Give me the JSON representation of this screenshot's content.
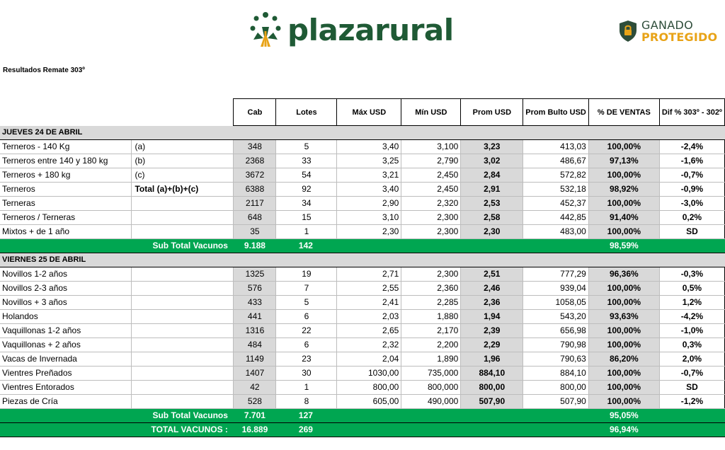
{
  "header": {
    "brand": "plazarural",
    "gp_line1": "GANADO",
    "gp_line2": "PROTEGIDO",
    "subtitle": "Resultados Remate 303º"
  },
  "columns": [
    "Cab",
    "Lotes",
    "Máx USD",
    "Mín USD",
    "Prom USD",
    "Prom Bulto USD",
    "% DE VENTAS",
    "Dif % 303º - 302º"
  ],
  "sections": [
    {
      "title": "JUEVES 24 DE ABRIL",
      "rows": [
        {
          "name": "Terneros - 140 Kg",
          "note": "(a)",
          "cab": "348",
          "lotes": "5",
          "max": "3,40",
          "min": "3,100",
          "prom": "3,23",
          "bulto": "413,03",
          "ventas": "100,00%",
          "dif": "-2,4%"
        },
        {
          "name": "Terneros entre 140 y 180 kg",
          "note": "(b)",
          "cab": "2368",
          "lotes": "33",
          "max": "3,25",
          "min": "2,790",
          "prom": "3,02",
          "bulto": "486,67",
          "ventas": "97,13%",
          "dif": "-1,6%"
        },
        {
          "name": "Terneros + 180 kg",
          "note": "(c)",
          "cab": "3672",
          "lotes": "54",
          "max": "3,21",
          "min": "2,450",
          "prom": "2,84",
          "bulto": "572,82",
          "ventas": "100,00%",
          "dif": "-0,7%"
        },
        {
          "name": "Terneros",
          "note": "Total (a)+(b)+(c)",
          "cab": "6388",
          "lotes": "92",
          "max": "3,40",
          "min": "2,450",
          "prom": "2,91",
          "bulto": "532,18",
          "ventas": "98,92%",
          "dif": "-0,9%"
        },
        {
          "name": "Terneras",
          "note": "",
          "cab": "2117",
          "lotes": "34",
          "max": "2,90",
          "min": "2,320",
          "prom": "2,53",
          "bulto": "452,37",
          "ventas": "100,00%",
          "dif": "-3,0%"
        },
        {
          "name": "Terneros / Terneras",
          "note": "",
          "cab": "648",
          "lotes": "15",
          "max": "3,10",
          "min": "2,300",
          "prom": "2,58",
          "bulto": "442,85",
          "ventas": "91,40%",
          "dif": "0,2%"
        },
        {
          "name": "Mixtos + de 1 año",
          "note": "",
          "cab": "35",
          "lotes": "1",
          "max": "2,30",
          "min": "2,300",
          "prom": "2,30",
          "bulto": "483,00",
          "ventas": "100,00%",
          "dif": "SD"
        }
      ],
      "subtotal": {
        "label": "Sub Total Vacunos",
        "cab": "9.188",
        "lotes": "142",
        "ventas": "98,59%"
      }
    },
    {
      "title": "VIERNES 25 DE ABRIL",
      "rows": [
        {
          "name": "Novillos 1-2 años",
          "note": "",
          "cab": "1325",
          "lotes": "19",
          "max": "2,71",
          "min": "2,300",
          "prom": "2,51",
          "bulto": "777,29",
          "ventas": "96,36%",
          "dif": "-0,3%"
        },
        {
          "name": "Novillos 2-3 años",
          "note": "",
          "cab": "576",
          "lotes": "7",
          "max": "2,55",
          "min": "2,360",
          "prom": "2,46",
          "bulto": "939,04",
          "ventas": "100,00%",
          "dif": "0,5%"
        },
        {
          "name": "Novillos + 3 años",
          "note": "",
          "cab": "433",
          "lotes": "5",
          "max": "2,41",
          "min": "2,285",
          "prom": "2,36",
          "bulto": "1058,05",
          "ventas": "100,00%",
          "dif": "1,2%"
        },
        {
          "name": "Holandos",
          "note": "",
          "cab": "441",
          "lotes": "6",
          "max": "2,03",
          "min": "1,880",
          "prom": "1,94",
          "bulto": "543,20",
          "ventas": "93,63%",
          "dif": "-4,2%"
        },
        {
          "name": "Vaquillonas 1-2 años",
          "note": "",
          "cab": "1316",
          "lotes": "22",
          "max": "2,65",
          "min": "2,170",
          "prom": "2,39",
          "bulto": "656,98",
          "ventas": "100,00%",
          "dif": "-1,0%"
        },
        {
          "name": "Vaquillonas + 2 años",
          "note": "",
          "cab": "484",
          "lotes": "6",
          "max": "2,32",
          "min": "2,200",
          "prom": "2,29",
          "bulto": "790,98",
          "ventas": "100,00%",
          "dif": "0,3%"
        },
        {
          "name": "Vacas de Invernada",
          "note": "",
          "cab": "1149",
          "lotes": "23",
          "max": "2,04",
          "min": "1,890",
          "prom": "1,96",
          "bulto": "790,63",
          "ventas": "86,20%",
          "dif": "2,0%"
        },
        {
          "name": "Vientres Preñados",
          "note": "",
          "cab": "1407",
          "lotes": "30",
          "max": "1030,00",
          "min": "735,000",
          "prom": "884,10",
          "bulto": "884,10",
          "ventas": "100,00%",
          "dif": "-0,7%"
        },
        {
          "name": "Vientres Entorados",
          "note": "",
          "cab": "42",
          "lotes": "1",
          "max": "800,00",
          "min": "800,000",
          "prom": "800,00",
          "bulto": "800,00",
          "ventas": "100,00%",
          "dif": "SD"
        },
        {
          "name": "Piezas de Cría",
          "note": "",
          "cab": "528",
          "lotes": "8",
          "max": "605,00",
          "min": "490,000",
          "prom": "507,90",
          "bulto": "507,90",
          "ventas": "100,00%",
          "dif": "-1,2%"
        }
      ],
      "subtotal": {
        "label": "Sub Total Vacunos",
        "cab": "7.701",
        "lotes": "127",
        "ventas": "95,05%"
      }
    }
  ],
  "total": {
    "label": "TOTAL VACUNOS :",
    "cab": "16.889",
    "lotes": "269",
    "ventas": "96,94%"
  },
  "colors": {
    "green": "#00a651",
    "gray": "#d9d9d9",
    "brand": "#1f5a35",
    "gold": "#e8a317"
  }
}
